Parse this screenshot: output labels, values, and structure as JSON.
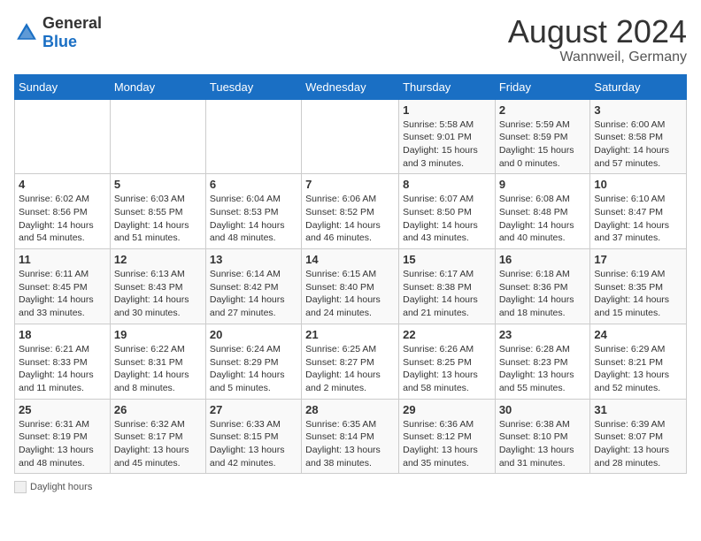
{
  "logo": {
    "general": "General",
    "blue": "Blue"
  },
  "header": {
    "month": "August 2024",
    "location": "Wannweil, Germany"
  },
  "weekdays": [
    "Sunday",
    "Monday",
    "Tuesday",
    "Wednesday",
    "Thursday",
    "Friday",
    "Saturday"
  ],
  "weeks": [
    [
      {
        "day": "",
        "info": ""
      },
      {
        "day": "",
        "info": ""
      },
      {
        "day": "",
        "info": ""
      },
      {
        "day": "",
        "info": ""
      },
      {
        "day": "1",
        "info": "Sunrise: 5:58 AM\nSunset: 9:01 PM\nDaylight: 15 hours\nand 3 minutes."
      },
      {
        "day": "2",
        "info": "Sunrise: 5:59 AM\nSunset: 8:59 PM\nDaylight: 15 hours\nand 0 minutes."
      },
      {
        "day": "3",
        "info": "Sunrise: 6:00 AM\nSunset: 8:58 PM\nDaylight: 14 hours\nand 57 minutes."
      }
    ],
    [
      {
        "day": "4",
        "info": "Sunrise: 6:02 AM\nSunset: 8:56 PM\nDaylight: 14 hours\nand 54 minutes."
      },
      {
        "day": "5",
        "info": "Sunrise: 6:03 AM\nSunset: 8:55 PM\nDaylight: 14 hours\nand 51 minutes."
      },
      {
        "day": "6",
        "info": "Sunrise: 6:04 AM\nSunset: 8:53 PM\nDaylight: 14 hours\nand 48 minutes."
      },
      {
        "day": "7",
        "info": "Sunrise: 6:06 AM\nSunset: 8:52 PM\nDaylight: 14 hours\nand 46 minutes."
      },
      {
        "day": "8",
        "info": "Sunrise: 6:07 AM\nSunset: 8:50 PM\nDaylight: 14 hours\nand 43 minutes."
      },
      {
        "day": "9",
        "info": "Sunrise: 6:08 AM\nSunset: 8:48 PM\nDaylight: 14 hours\nand 40 minutes."
      },
      {
        "day": "10",
        "info": "Sunrise: 6:10 AM\nSunset: 8:47 PM\nDaylight: 14 hours\nand 37 minutes."
      }
    ],
    [
      {
        "day": "11",
        "info": "Sunrise: 6:11 AM\nSunset: 8:45 PM\nDaylight: 14 hours\nand 33 minutes."
      },
      {
        "day": "12",
        "info": "Sunrise: 6:13 AM\nSunset: 8:43 PM\nDaylight: 14 hours\nand 30 minutes."
      },
      {
        "day": "13",
        "info": "Sunrise: 6:14 AM\nSunset: 8:42 PM\nDaylight: 14 hours\nand 27 minutes."
      },
      {
        "day": "14",
        "info": "Sunrise: 6:15 AM\nSunset: 8:40 PM\nDaylight: 14 hours\nand 24 minutes."
      },
      {
        "day": "15",
        "info": "Sunrise: 6:17 AM\nSunset: 8:38 PM\nDaylight: 14 hours\nand 21 minutes."
      },
      {
        "day": "16",
        "info": "Sunrise: 6:18 AM\nSunset: 8:36 PM\nDaylight: 14 hours\nand 18 minutes."
      },
      {
        "day": "17",
        "info": "Sunrise: 6:19 AM\nSunset: 8:35 PM\nDaylight: 14 hours\nand 15 minutes."
      }
    ],
    [
      {
        "day": "18",
        "info": "Sunrise: 6:21 AM\nSunset: 8:33 PM\nDaylight: 14 hours\nand 11 minutes."
      },
      {
        "day": "19",
        "info": "Sunrise: 6:22 AM\nSunset: 8:31 PM\nDaylight: 14 hours\nand 8 minutes."
      },
      {
        "day": "20",
        "info": "Sunrise: 6:24 AM\nSunset: 8:29 PM\nDaylight: 14 hours\nand 5 minutes."
      },
      {
        "day": "21",
        "info": "Sunrise: 6:25 AM\nSunset: 8:27 PM\nDaylight: 14 hours\nand 2 minutes."
      },
      {
        "day": "22",
        "info": "Sunrise: 6:26 AM\nSunset: 8:25 PM\nDaylight: 13 hours\nand 58 minutes."
      },
      {
        "day": "23",
        "info": "Sunrise: 6:28 AM\nSunset: 8:23 PM\nDaylight: 13 hours\nand 55 minutes."
      },
      {
        "day": "24",
        "info": "Sunrise: 6:29 AM\nSunset: 8:21 PM\nDaylight: 13 hours\nand 52 minutes."
      }
    ],
    [
      {
        "day": "25",
        "info": "Sunrise: 6:31 AM\nSunset: 8:19 PM\nDaylight: 13 hours\nand 48 minutes."
      },
      {
        "day": "26",
        "info": "Sunrise: 6:32 AM\nSunset: 8:17 PM\nDaylight: 13 hours\nand 45 minutes."
      },
      {
        "day": "27",
        "info": "Sunrise: 6:33 AM\nSunset: 8:15 PM\nDaylight: 13 hours\nand 42 minutes."
      },
      {
        "day": "28",
        "info": "Sunrise: 6:35 AM\nSunset: 8:14 PM\nDaylight: 13 hours\nand 38 minutes."
      },
      {
        "day": "29",
        "info": "Sunrise: 6:36 AM\nSunset: 8:12 PM\nDaylight: 13 hours\nand 35 minutes."
      },
      {
        "day": "30",
        "info": "Sunrise: 6:38 AM\nSunset: 8:10 PM\nDaylight: 13 hours\nand 31 minutes."
      },
      {
        "day": "31",
        "info": "Sunrise: 6:39 AM\nSunset: 8:07 PM\nDaylight: 13 hours\nand 28 minutes."
      }
    ]
  ],
  "footer": {
    "legend_label": "Daylight hours"
  }
}
